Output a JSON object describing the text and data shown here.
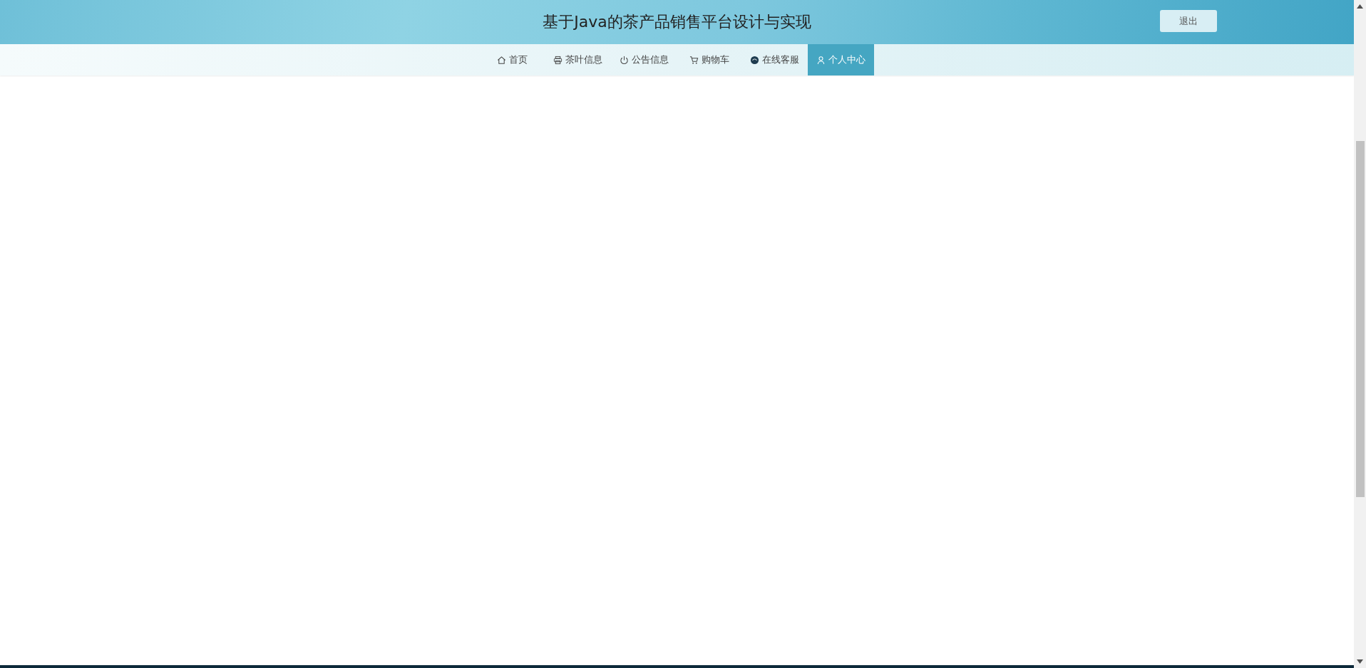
{
  "header": {
    "title": "基于Java的茶产品销售平台设计与实现",
    "logout_button": "退出"
  },
  "nav": [
    {
      "label": "首页",
      "selected": false
    },
    {
      "label": "茶叶信息",
      "selected": false
    },
    {
      "label": "公告信息",
      "selected": false
    },
    {
      "label": "购物车",
      "selected": false
    },
    {
      "label": "在线客服",
      "selected": false
    },
    {
      "label": "个人中心",
      "selected": true
    }
  ]
}
